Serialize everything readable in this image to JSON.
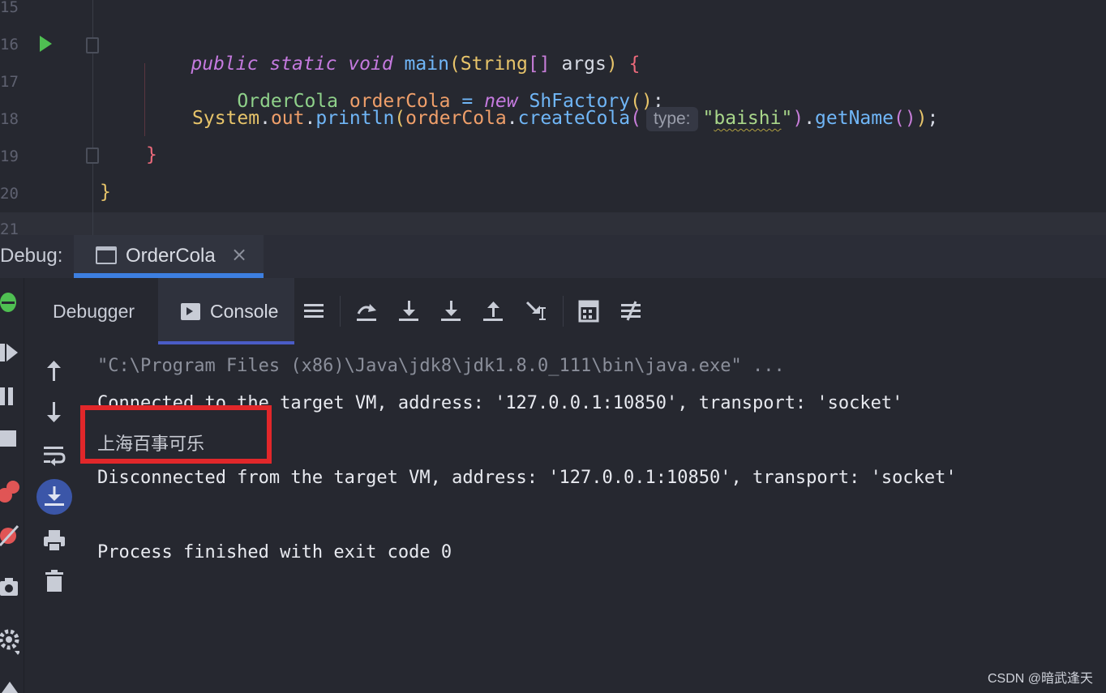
{
  "editor": {
    "line_numbers": [
      "15",
      "16",
      "17",
      "18",
      "19",
      "20",
      "21"
    ],
    "lines": {
      "l16": {
        "kw1": "public",
        "kw2": "static",
        "kw3": "void",
        "fn": "main",
        "open": "(",
        "type": "String",
        "brackets": "[]",
        "arg": " args",
        "close": ")",
        "brace": "{"
      },
      "l17": {
        "cls": "OrderCola",
        "var": "orderCola",
        "eq": "=",
        "kw": "new",
        "ctor": "ShFactory",
        "parens": "()",
        "semi": ";"
      },
      "l18": {
        "sys": "System",
        "dot1": ".",
        "out": "out",
        "dot2": ".",
        "println": "println",
        "p1": "(",
        "obj": "orderCola",
        "dot3": ".",
        "method": "createCola",
        "p2": "(",
        "hint": "type:",
        "q1": "\"",
        "str": "baishi",
        "q2": "\"",
        "p3": ")",
        "dot4": ".",
        "getname": "getName",
        "p4": "()",
        "p5": ")",
        "semi": ";"
      },
      "l19": {
        "brace": "}"
      },
      "l20": {
        "brace": "}"
      }
    }
  },
  "debug_bar": {
    "label": "Debug:",
    "tab_label": "OrderCola",
    "close_glyph": "×"
  },
  "panel": {
    "tab_debugger": "Debugger",
    "tab_console": "Console"
  },
  "console": {
    "lines": [
      "\"C:\\Program Files (x86)\\Java\\jdk8\\jdk1.8.0_111\\bin\\java.exe\" ...",
      "Connected to the target VM, address: '127.0.0.1:10850', transport: 'socket'",
      "上海百事可乐",
      "Disconnected from the target VM, address: '127.0.0.1:10850', transport: 'socket'",
      "Process finished with exit code 0"
    ]
  },
  "watermark": "CSDN @暗武逢天",
  "colors": {
    "accent_blue": "#3d7fe0",
    "highlight_red": "#e1272a",
    "run_green": "#4fbf52"
  }
}
